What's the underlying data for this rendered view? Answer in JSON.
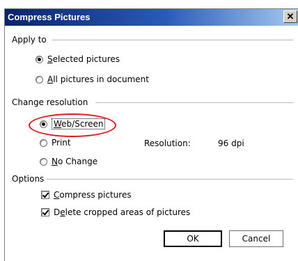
{
  "dialog": {
    "title": "Compress Pictures",
    "close_glyph": "✕"
  },
  "apply_to": {
    "label": "Apply to",
    "selected_pictures": {
      "pre": "",
      "accel": "S",
      "post": "elected pictures",
      "checked": true
    },
    "all_pictures": {
      "pre": "",
      "accel": "A",
      "post": "ll pictures in document",
      "checked": false
    }
  },
  "change_resolution": {
    "label": "Change resolution",
    "web_screen": {
      "pre": "",
      "accel": "W",
      "post": "eb/Screen",
      "checked": true
    },
    "print": {
      "label": "Print",
      "checked": false
    },
    "no_change": {
      "pre": "",
      "accel": "N",
      "post": "o Change",
      "checked": false
    },
    "resolution_label": "Resolution:",
    "resolution_value": "96 dpi"
  },
  "options": {
    "label": "Options",
    "compress_pictures": {
      "pre": "",
      "accel": "C",
      "post": "ompress pictures",
      "checked": true
    },
    "delete_cropped": {
      "pre": "D",
      "accel": "e",
      "post": "lete cropped areas of pictures",
      "checked": true
    }
  },
  "buttons": {
    "ok": "OK",
    "cancel": "Cancel"
  },
  "colors": {
    "title_bar_start": "#0a246a",
    "title_bar_end": "#a6caf0",
    "highlight_ellipse": "#e0181c"
  }
}
